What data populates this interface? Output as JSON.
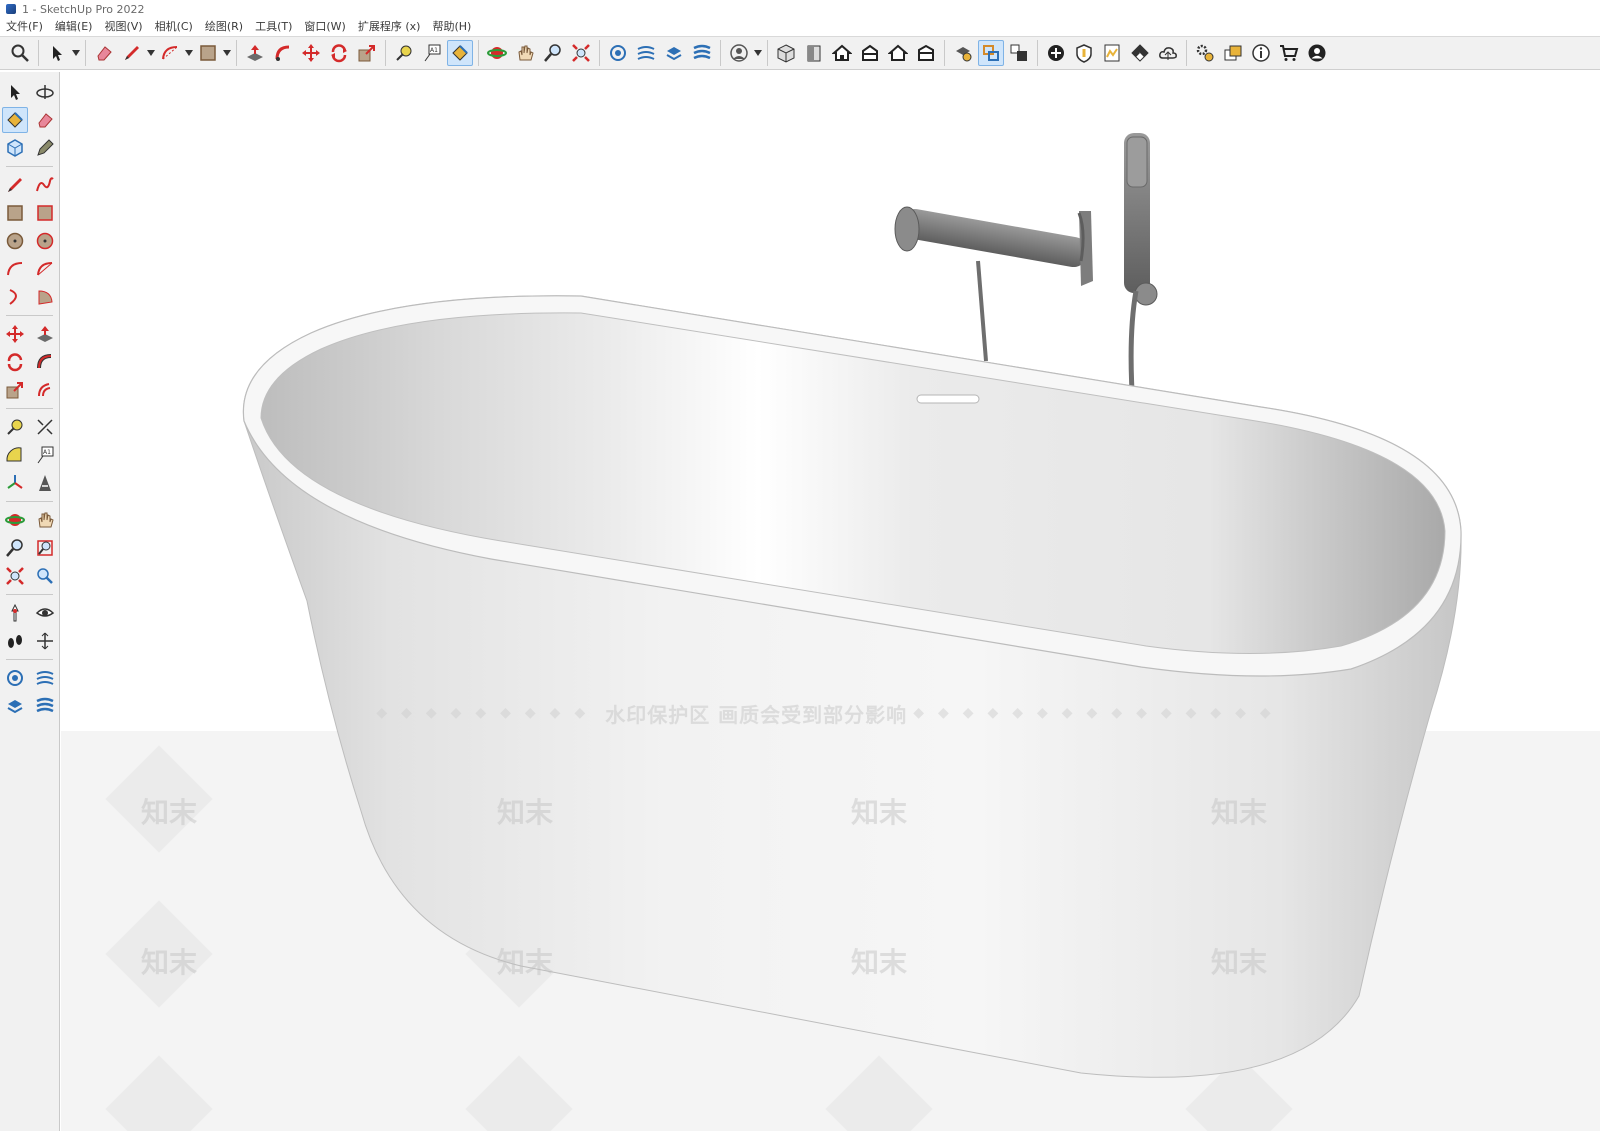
{
  "window": {
    "title": "1 - SketchUp Pro 2022"
  },
  "menu": {
    "items": [
      {
        "label": "文件(F)"
      },
      {
        "label": "编辑(E)"
      },
      {
        "label": "视图(V)"
      },
      {
        "label": "相机(C)"
      },
      {
        "label": "绘图(R)"
      },
      {
        "label": "工具(T)"
      },
      {
        "label": "窗口(W)"
      },
      {
        "label": "扩展程序 (x)"
      },
      {
        "label": "帮助(H)"
      }
    ]
  },
  "toolbar": {
    "tools": [
      "search-icon",
      "select-icon",
      "eraser-icon",
      "pencil-icon",
      "arc-icon",
      "rectangle-icon",
      "push-pull-icon",
      "follow-me-icon",
      "move-icon",
      "rotate-icon",
      "scale-icon",
      "tape-measure-icon",
      "text-icon",
      "paint-bucket-icon",
      "orbit-icon",
      "pan-icon",
      "zoom-icon",
      "zoom-extents-icon",
      "warehouse-icon",
      "extension-icon",
      "solid-tools-icon",
      "sandbox-icon",
      "account-icon",
      "iso-view-icon",
      "front-view-icon",
      "home-view-icon",
      "top-view-icon",
      "right-view-icon",
      "back-view-icon",
      "style-icon",
      "section-icon",
      "camera-icon",
      "add-icon",
      "shield-icon",
      "layout-icon",
      "checker-icon",
      "cloud-icon",
      "settings-icon",
      "layers-icon",
      "info-icon",
      "cart-icon",
      "profile-icon"
    ]
  },
  "watermark": {
    "banner": "水印保护区  画质会受到部分影响",
    "tile_text": "知末"
  },
  "colors": {
    "accent": "#7fb3e6",
    "active_bg": "#cfe5fb",
    "toolbar_bg": "#f1f1f1",
    "tool_red": "#d42a2a"
  }
}
